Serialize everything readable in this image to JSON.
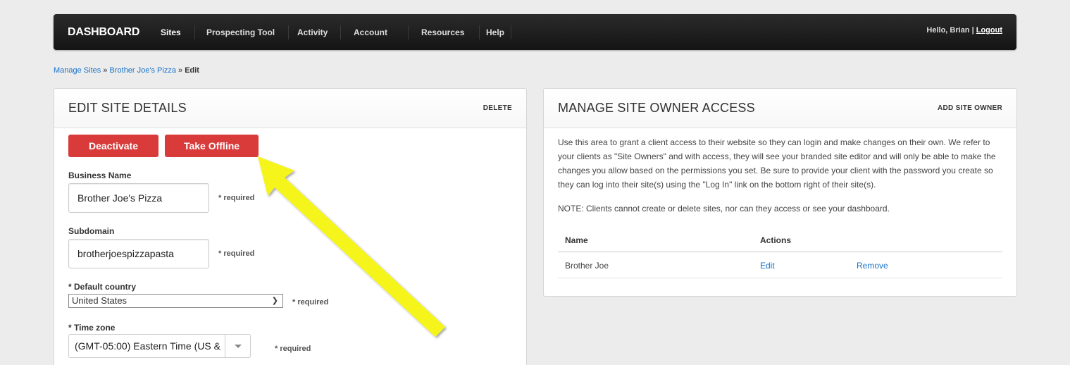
{
  "navbar": {
    "brand": "DASHBOARD",
    "items": [
      {
        "label": "Sites"
      },
      {
        "label": "Prospecting Tool"
      },
      {
        "label": "Activity"
      },
      {
        "label": "Account"
      },
      {
        "label": "Resources"
      },
      {
        "label": "Help"
      }
    ],
    "greeting": "Hello, Brian",
    "separator": "|",
    "logout": "Logout"
  },
  "breadcrumb": {
    "manage_sites": "Manage Sites",
    "sep1": "»",
    "site": "Brother Joe's Pizza",
    "sep2": "»",
    "current": "Edit"
  },
  "edit_panel": {
    "title": "EDIT SITE DETAILS",
    "delete_label": "DELETE",
    "deactivate_label": "Deactivate",
    "take_offline_label": "Take Offline",
    "business_name_label": "Business Name",
    "business_name_value": "Brother Joe's Pizza",
    "subdomain_label": "Subdomain",
    "subdomain_value": "brotherjoespizzapasta",
    "required": "* required",
    "country_label": "* Default country",
    "country_value": "United States",
    "timezone_label": "* Time zone",
    "timezone_value": "(GMT-05:00) Eastern Time (US &"
  },
  "owner_panel": {
    "title": "MANAGE SITE OWNER ACCESS",
    "add_label": "ADD SITE OWNER",
    "description": "Use this area to grant a client access to their website so they can login and make changes on their own. We refer to your clients as \"Site Owners\" and with access, they will see your branded site editor and will only be able to make the changes you allow based on the permissions you set. Be sure to provide your client with the password you create so they can log into their site(s) using the \"Log In\" link on the bottom right of their site(s).",
    "note": "NOTE: Clients cannot create or delete sites, nor can they access or see your dashboard.",
    "columns": {
      "name": "Name",
      "actions": "Actions"
    },
    "rows": [
      {
        "name": "Brother Joe",
        "edit": "Edit",
        "remove": "Remove"
      }
    ]
  },
  "colors": {
    "accent_red": "#d93b3b",
    "link_blue": "#1a73c9",
    "annotation_arrow": "#f5f51e"
  }
}
